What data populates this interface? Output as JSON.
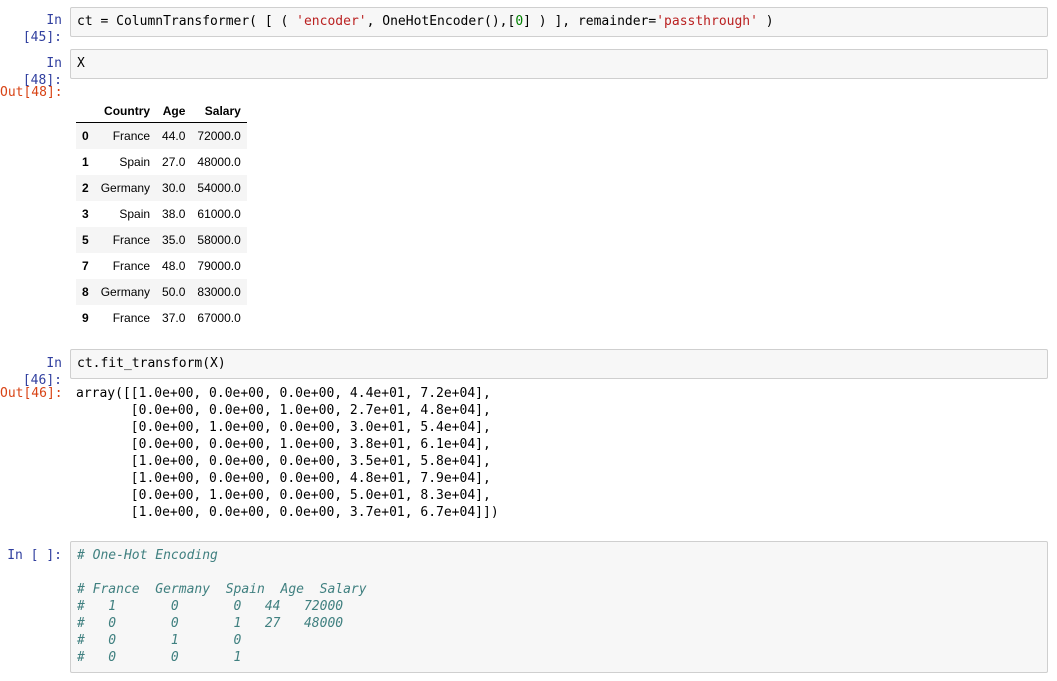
{
  "cells": {
    "c45": {
      "prompt": "In [45]:",
      "code": {
        "p1": "ct = ColumnTransformer( [ ( ",
        "s1": "'encoder'",
        "p2": ", OneHotEncoder(),[",
        "n1": "0",
        "p3": "] ) ], remainder=",
        "s2": "'passthrough'",
        "p4": " )"
      }
    },
    "c48": {
      "prompt": "In [48]:",
      "code": "X",
      "out_prompt": "Out[48]:",
      "table": {
        "columns": [
          "",
          "Country",
          "Age",
          "Salary"
        ],
        "rows": [
          {
            "index": "0",
            "country": "France",
            "age": "44.0",
            "salary": "72000.0"
          },
          {
            "index": "1",
            "country": "Spain",
            "age": "27.0",
            "salary": "48000.0"
          },
          {
            "index": "2",
            "country": "Germany",
            "age": "30.0",
            "salary": "54000.0"
          },
          {
            "index": "3",
            "country": "Spain",
            "age": "38.0",
            "salary": "61000.0"
          },
          {
            "index": "5",
            "country": "France",
            "age": "35.0",
            "salary": "58000.0"
          },
          {
            "index": "7",
            "country": "France",
            "age": "48.0",
            "salary": "79000.0"
          },
          {
            "index": "8",
            "country": "Germany",
            "age": "50.0",
            "salary": "83000.0"
          },
          {
            "index": "9",
            "country": "France",
            "age": "37.0",
            "salary": "67000.0"
          }
        ]
      }
    },
    "c46": {
      "prompt": "In [46]:",
      "code": "ct.fit_transform(X)",
      "out_prompt": "Out[46]:",
      "output_lines": [
        "array([[1.0e+00, 0.0e+00, 0.0e+00, 4.4e+01, 7.2e+04],",
        "       [0.0e+00, 0.0e+00, 1.0e+00, 2.7e+01, 4.8e+04],",
        "       [0.0e+00, 1.0e+00, 0.0e+00, 3.0e+01, 5.4e+04],",
        "       [0.0e+00, 0.0e+00, 1.0e+00, 3.8e+01, 6.1e+04],",
        "       [1.0e+00, 0.0e+00, 0.0e+00, 3.5e+01, 5.8e+04],",
        "       [1.0e+00, 0.0e+00, 0.0e+00, 4.8e+01, 7.9e+04],",
        "       [0.0e+00, 1.0e+00, 0.0e+00, 5.0e+01, 8.3e+04],",
        "       [1.0e+00, 0.0e+00, 0.0e+00, 3.7e+01, 6.7e+04]])"
      ]
    },
    "cempty": {
      "prompt": "In [ ]:",
      "comment_lines": [
        "# One-Hot Encoding",
        "",
        "# France  Germany  Spain  Age  Salary",
        "#   1       0       0   44   72000",
        "#   0       0       1   27   48000",
        "#   0       1       0",
        "#   0       0       1"
      ]
    }
  }
}
